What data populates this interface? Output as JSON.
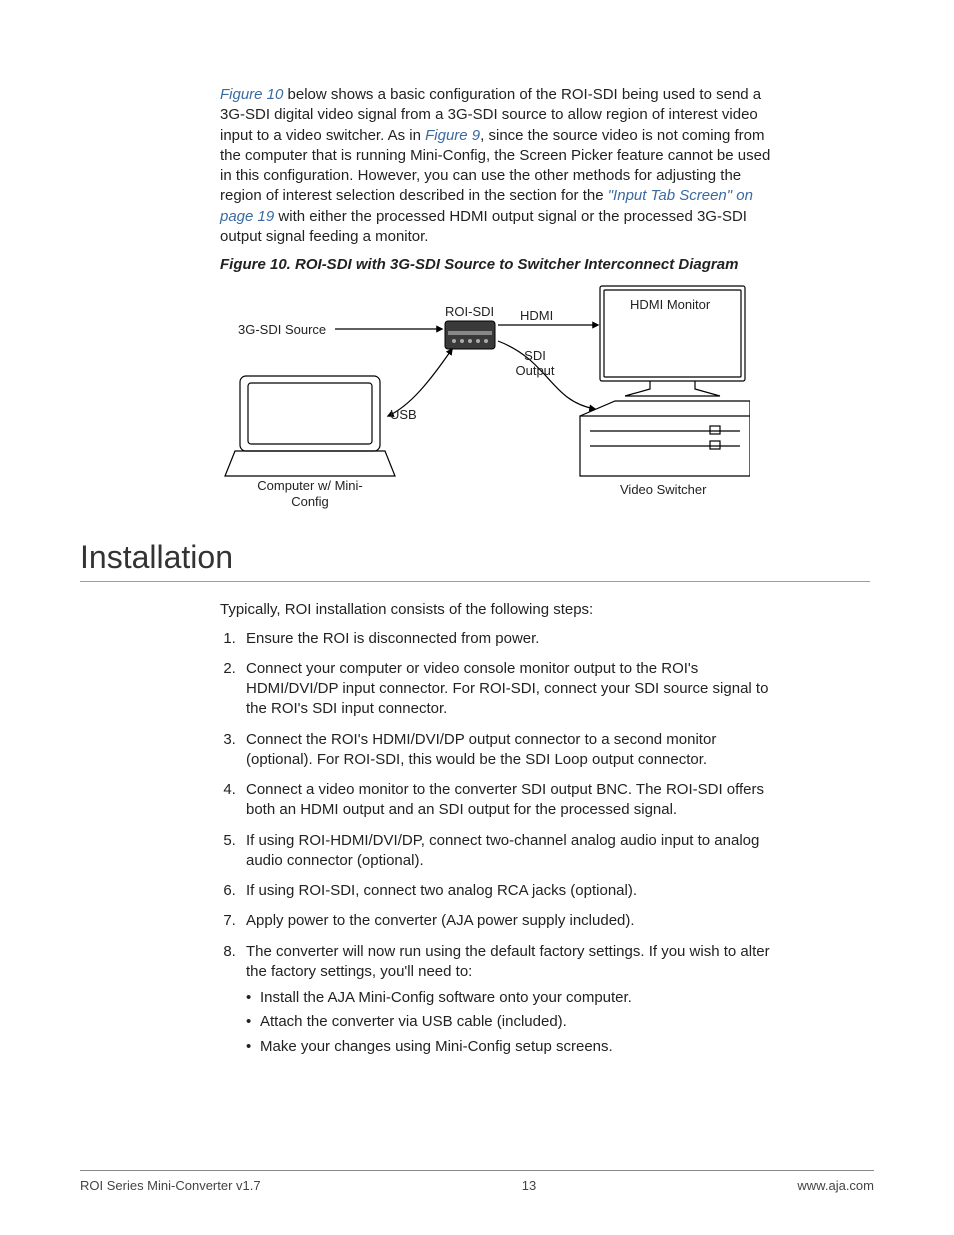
{
  "intro": {
    "ref1": "Figure 10",
    "seg1": " below shows a basic configuration of the ROI-SDI being used to send a 3G-SDI digital video signal from a 3G-SDI source to allow region of interest video input to a video switcher. As in ",
    "ref2": "Figure 9",
    "seg2": ", since the source video is not coming from the computer that is running Mini-Config, the Screen Picker feature cannot be used in this configuration. However, you can use the other methods for adjusting the region of interest selection described in the section for the ",
    "ref3": "\"Input Tab Screen\" on page 19",
    "seg3": " with either the processed HDMI output signal or the processed 3G-SDI output signal feeding a monitor."
  },
  "figure": {
    "caption": "Figure 10.  ROI-SDI with 3G-SDI Source to Switcher Interconnect Diagram",
    "labels": {
      "source": "3G-SDI Source",
      "roi": "ROI-SDI",
      "hdmi": "HDMI",
      "sdi": "SDI Output",
      "usb": "USB",
      "computer": "Computer w/ Mini-Config",
      "monitor": "HDMI Monitor",
      "switcher": "Video Switcher"
    }
  },
  "section": {
    "title": "Installation",
    "lead": "Typically, ROI installation consists of the following steps:",
    "steps": [
      "Ensure the ROI is disconnected from power.",
      "Connect your computer or video console monitor output to the ROI's HDMI/DVI/DP input connector. For ROI-SDI, connect your SDI source signal to the ROI's SDI input connector.",
      "Connect the ROI's HDMI/DVI/DP output connector to a second monitor (optional). For ROI-SDI, this would be the SDI Loop output connector.",
      "Connect a video monitor to the converter SDI output BNC. The ROI-SDI offers both an HDMI output and an SDI output for the processed signal.",
      "If using ROI-HDMI/DVI/DP, connect two-channel analog audio input to analog audio connector (optional).",
      "If using ROI-SDI, connect two analog RCA jacks (optional).",
      "Apply power to the converter (AJA power supply included).",
      "The converter will now run using the default factory settings. If you wish to alter the factory settings, you'll need to:"
    ],
    "substeps": [
      "Install the AJA Mini-Config software onto your computer.",
      "Attach the converter via USB cable (included).",
      "Make your changes using Mini-Config setup screens."
    ]
  },
  "footer": {
    "left": "ROI Series Mini-Converter v1.7",
    "center": "13",
    "right": "www.aja.com"
  }
}
